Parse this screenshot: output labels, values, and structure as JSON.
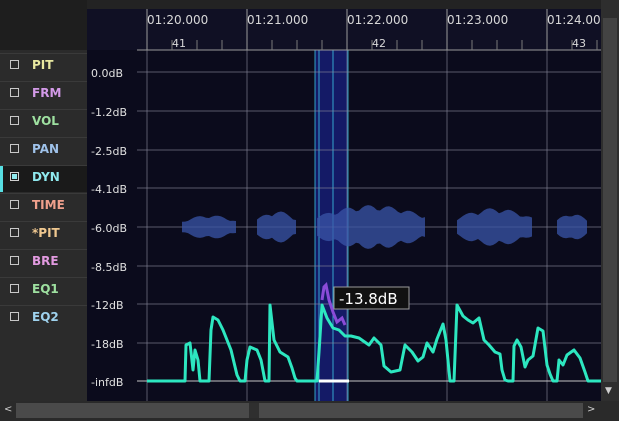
{
  "params": [
    {
      "label": "PIT",
      "color": "#e8e8a0",
      "active": false
    },
    {
      "label": "FRM",
      "color": "#d39ae8",
      "active": false
    },
    {
      "label": "VOL",
      "color": "#9ee0a0",
      "active": false
    },
    {
      "label": "PAN",
      "color": "#9fc2ea",
      "active": false
    },
    {
      "label": "DYN",
      "color": "#8fe9ee",
      "active": true
    },
    {
      "label": "TIME",
      "color": "#f0a08c",
      "active": false
    },
    {
      "label": "*PIT",
      "color": "#f0c890",
      "active": false
    },
    {
      "label": "BRE",
      "color": "#e29ae0",
      "active": false
    },
    {
      "label": "EQ1",
      "color": "#9ee0a0",
      "active": false
    },
    {
      "label": "EQ2",
      "color": "#9fd2ee",
      "active": false
    }
  ],
  "timeline": {
    "times": [
      "01:20.000",
      "01:21.000",
      "01:22.000",
      "01:23.000",
      "01:24.000"
    ],
    "measures": [
      "41",
      "42",
      "43"
    ]
  },
  "db_labels": [
    "0.0dB",
    "-1.2dB",
    "-2.5dB",
    "-4.1dB",
    "-6.0dB",
    "-8.5dB",
    "-12dB",
    "-18dB",
    "-infdB"
  ],
  "tooltip": "-13.8dB",
  "close_icon": "×",
  "scroll": {
    "up": "▲",
    "down": "▼",
    "left": "<",
    "right": ">"
  },
  "colors": {
    "curve": "#2de7c0",
    "vibrato": "#8a4bd8",
    "selection": "#141a66",
    "wave": "#3a56a8"
  }
}
